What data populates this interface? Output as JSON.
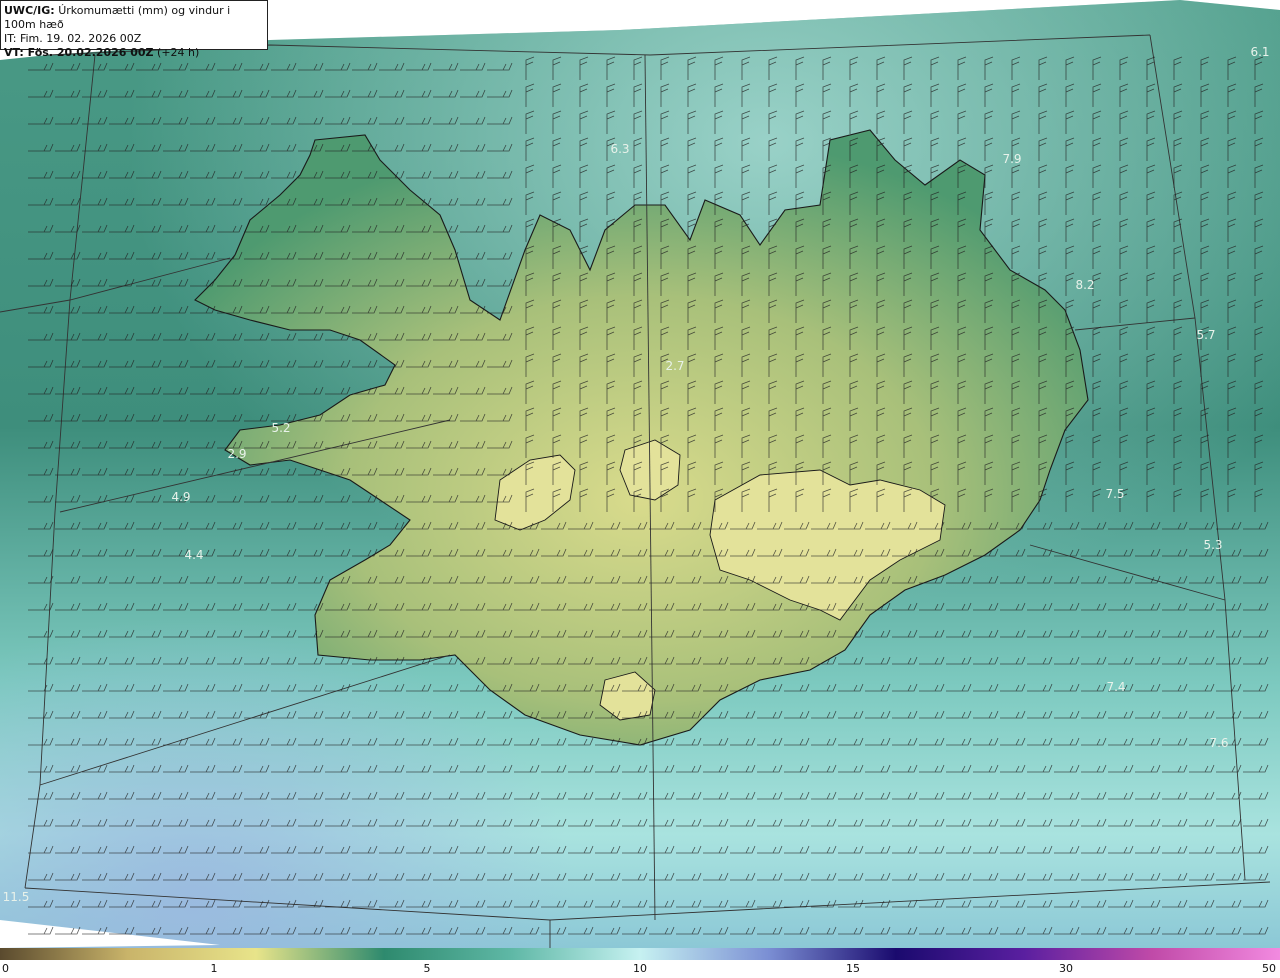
{
  "header": {
    "product": "UWC/IG:",
    "title": "Úrkomumætti (mm) og vindur i 100m hæð",
    "init_time": "IT: Fim. 19. 02. 2026 00Z",
    "valid_label": "VT: Fös. 20.02.2026 00Z",
    "valid_offset": "(+24 h)"
  },
  "colorbar": {
    "ticks": [
      "0",
      "1",
      "5",
      "10",
      "15",
      "30",
      "50"
    ],
    "stops": [
      "#5a4a2e",
      "#c9b46a",
      "#e8e48a",
      "#2e8a6e",
      "#5fb8a6",
      "#c6f1f1",
      "#7b8fd4",
      "#1a0a6e",
      "#5a1fa0",
      "#c04aa8",
      "#f28ae0"
    ]
  },
  "values": [
    "6.1",
    "6.3",
    "7.9",
    "8.2",
    "5.7",
    "2.7",
    "5.2",
    "2.9",
    "4.9",
    "4.4",
    "7.5",
    "5.3",
    "7.4",
    "7.6",
    "11.5"
  ],
  "colors": {
    "sea": "#3d8f80",
    "sea_light": "#8fd6d0",
    "land_low": "#4f9a72",
    "land_high": "#d6d88a",
    "coast": "#1a1a1a",
    "grid": "#333333",
    "barb": "#222222"
  }
}
